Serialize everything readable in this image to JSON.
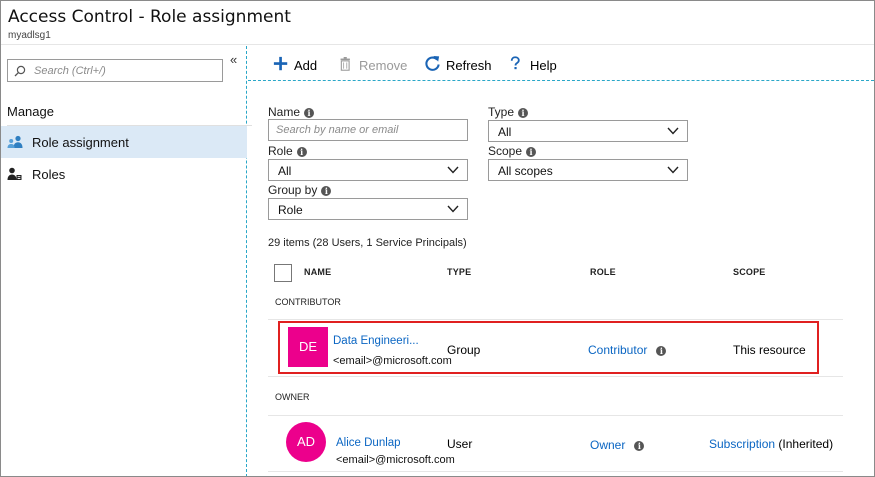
{
  "header": {
    "title": "Access Control - Role assignment",
    "subtitle": "myadlsg1"
  },
  "sidebar": {
    "search_placeholder": "Search (Ctrl+/)",
    "collapse_glyph": "«",
    "section_label": "Manage",
    "items": [
      {
        "label": "Role assignment",
        "icon": "role-assignment-icon",
        "active": true
      },
      {
        "label": "Roles",
        "icon": "roles-icon",
        "active": false
      }
    ]
  },
  "toolbar": {
    "add": "Add",
    "remove": "Remove",
    "refresh": "Refresh",
    "help": "Help"
  },
  "filters": {
    "name_label": "Name",
    "name_placeholder": "Search by name or email",
    "type_label": "Type",
    "type_value": "All",
    "role_label": "Role",
    "role_value": "All",
    "scope_label": "Scope",
    "scope_value": "All scopes",
    "groupby_label": "Group by",
    "groupby_value": "Role"
  },
  "summary": "29 items (28 Users, 1 Service Principals)",
  "table": {
    "columns": [
      "NAME",
      "TYPE",
      "ROLE",
      "SCOPE"
    ],
    "groups": [
      {
        "label": "CONTRIBUTOR",
        "rows": [
          {
            "initials": "DE",
            "name": "Data Engineeri...",
            "email": "<email>@microsoft.com",
            "type": "Group",
            "role": "Contributor",
            "scope": "This resource",
            "scope_suffix": ""
          }
        ]
      },
      {
        "label": "OWNER",
        "rows": [
          {
            "initials": "AD",
            "name": "Alice Dunlap",
            "email": "<email>@microsoft.com",
            "type": "User",
            "role": "Owner",
            "scope": "Subscription",
            "scope_suffix": "(Inherited)"
          }
        ]
      }
    ]
  },
  "colors": {
    "accent": "#0b66c3",
    "avatar": "#ec008c",
    "highlight": "#e02020",
    "active_nav": "#dbe9f6"
  }
}
